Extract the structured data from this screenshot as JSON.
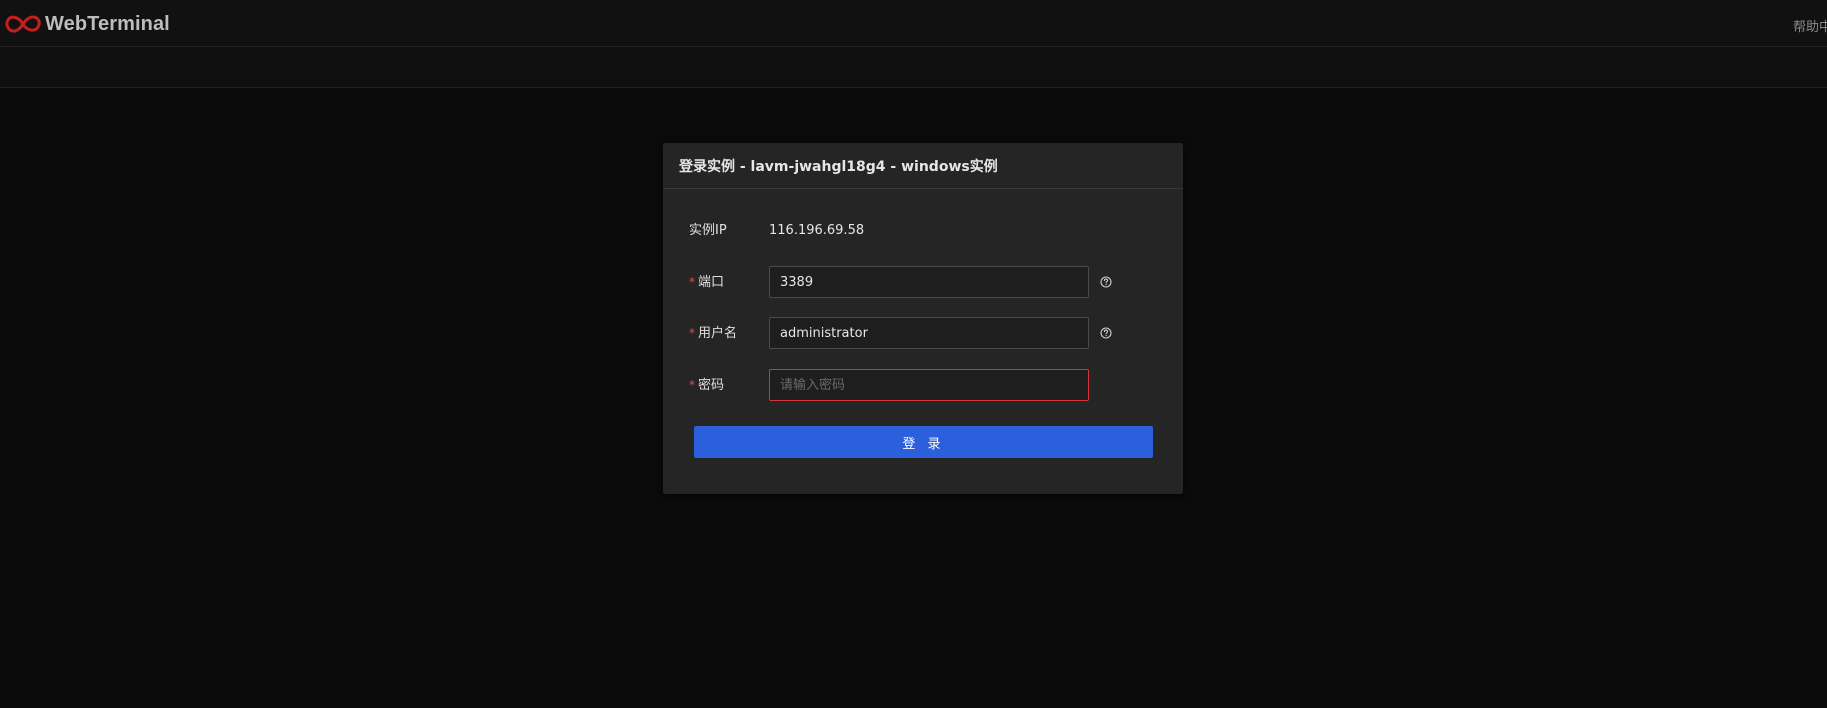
{
  "header": {
    "brand": "WebTerminal",
    "help_link": "帮助中心",
    "logo_color": "#c41e1e"
  },
  "dialog": {
    "title": "登录实例 - lavm-jwahgl18g4 - windows实例",
    "instance_ip": {
      "label": "实例IP",
      "value": "116.196.69.58"
    },
    "port": {
      "label": "端口",
      "value": "3389",
      "required": true,
      "help_icon": "question-circle-icon"
    },
    "username": {
      "label": "用户名",
      "value": "administrator",
      "required": true,
      "help_icon": "question-circle-icon"
    },
    "password": {
      "label": "密码",
      "value": "",
      "placeholder": "请输入密码",
      "required": true,
      "state": "error"
    },
    "login_button": "登 录"
  },
  "colors": {
    "background": "#0b0b0b",
    "dialog": "#252525",
    "primary": "#2b5fdb",
    "error": "#d4333b",
    "required_star": "#e5484d"
  }
}
